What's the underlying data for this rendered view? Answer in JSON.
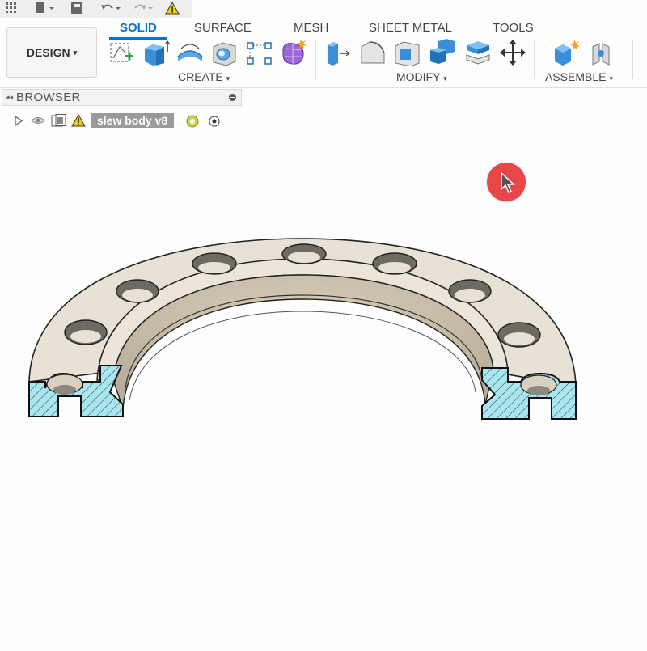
{
  "ribbon": {
    "workspace_button": "DESIGN",
    "tabs": [
      "SOLID",
      "SURFACE",
      "MESH",
      "SHEET METAL",
      "TOOLS"
    ],
    "active_tab": "SOLID",
    "groups": {
      "create": "CREATE",
      "modify": "MODIFY",
      "assemble": "ASSEMBLE"
    }
  },
  "browser": {
    "title": "BROWSER",
    "root_node": "slew body v8"
  },
  "viewport": {
    "model": "slew bearing flange section view",
    "section_fill": "#a9e6ef",
    "body_color": "#e8e2d6"
  },
  "colors": {
    "accent": "#0a72c9",
    "cursor_badge": "#e8474a",
    "warning": "#f2d100"
  }
}
